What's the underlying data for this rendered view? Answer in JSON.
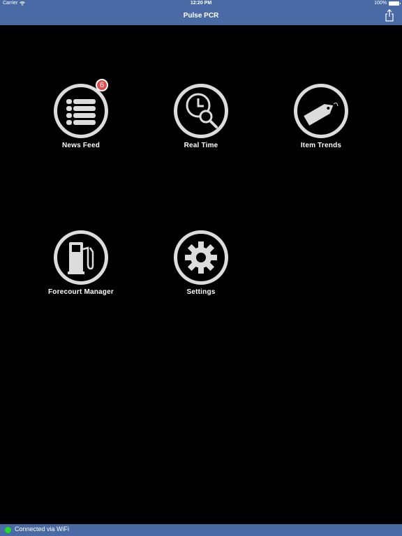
{
  "status_bar": {
    "carrier": "Carrier",
    "time": "12:20 PM",
    "battery": "100%"
  },
  "nav": {
    "title": "Pulse PCR",
    "share_icon": "share-icon"
  },
  "tiles": [
    {
      "label": "News Feed",
      "icon": "list-icon",
      "badge": "6"
    },
    {
      "label": "Real Time",
      "icon": "clock-search-icon"
    },
    {
      "label": "Item Trends",
      "icon": "tag-icon"
    },
    {
      "label": "Forecourt Manager",
      "icon": "fuel-pump-icon"
    },
    {
      "label": "Settings",
      "icon": "gear-icon"
    }
  ],
  "footer": {
    "connection_text": "Connected via WiFi",
    "connection_color": "#22dd22"
  },
  "colors": {
    "bar_blue": "#4a6aa5",
    "background": "#000000",
    "icon_gray": "#dcdcdc",
    "badge_red": "#e24b4b"
  }
}
